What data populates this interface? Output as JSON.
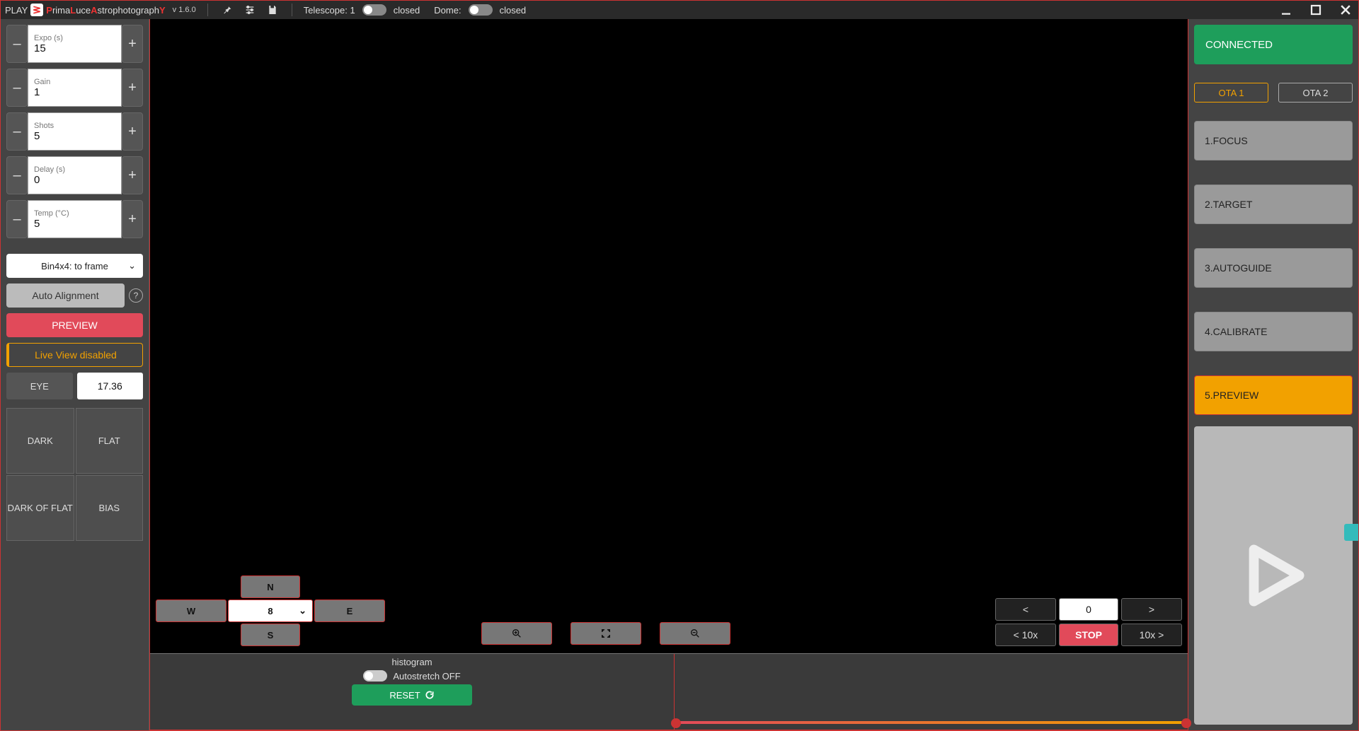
{
  "menubar": {
    "app": "PLAY",
    "title_html_pre": "P",
    "title_mid1": "rima",
    "title_L": "L",
    "title_mid2": "uce",
    "title_A": "A",
    "title_mid3": "strophotograph",
    "title_Y": "Y",
    "version": "v 1.6.0",
    "telescope_label": "Telescope: 1",
    "telescope_state": "closed",
    "dome_label": "Dome:",
    "dome_state": "closed"
  },
  "left": {
    "expo": {
      "label": "Expo (s)",
      "value": "15"
    },
    "gain": {
      "label": "Gain",
      "value": "1"
    },
    "shots": {
      "label": "Shots",
      "value": "5"
    },
    "delay": {
      "label": "Delay (s)",
      "value": "0"
    },
    "temp": {
      "label": "Temp (°C)",
      "value": "5"
    },
    "binning": "Bin4x4: to frame",
    "auto_align": "Auto Alignment",
    "preview": "PREVIEW",
    "liveview": "Live View disabled",
    "eye_label": "EYE",
    "eye_value": "17.36",
    "cal": {
      "dark": "DARK",
      "flat": "FLAT",
      "darkflat": "DARK OF FLAT",
      "bias": "BIAS"
    }
  },
  "center": {
    "dpad": {
      "n": "N",
      "s": "S",
      "e": "E",
      "w": "W",
      "speed": "8"
    },
    "rot": {
      "left": "<",
      "val": "0",
      "right": ">",
      "left10": "< 10x",
      "stop": "STOP",
      "right10": "10x >"
    },
    "hist": {
      "title": "histogram",
      "autostretch": "Autostretch OFF",
      "reset": "RESET"
    }
  },
  "right": {
    "status": "CONNECTED",
    "ota1": "OTA 1",
    "ota2": "OTA 2",
    "steps": {
      "focus": "1.FOCUS",
      "target": "2.TARGET",
      "autoguide": "3.AUTOGUIDE",
      "calibrate": "4.CALIBRATE",
      "preview": "5.PREVIEW"
    }
  }
}
